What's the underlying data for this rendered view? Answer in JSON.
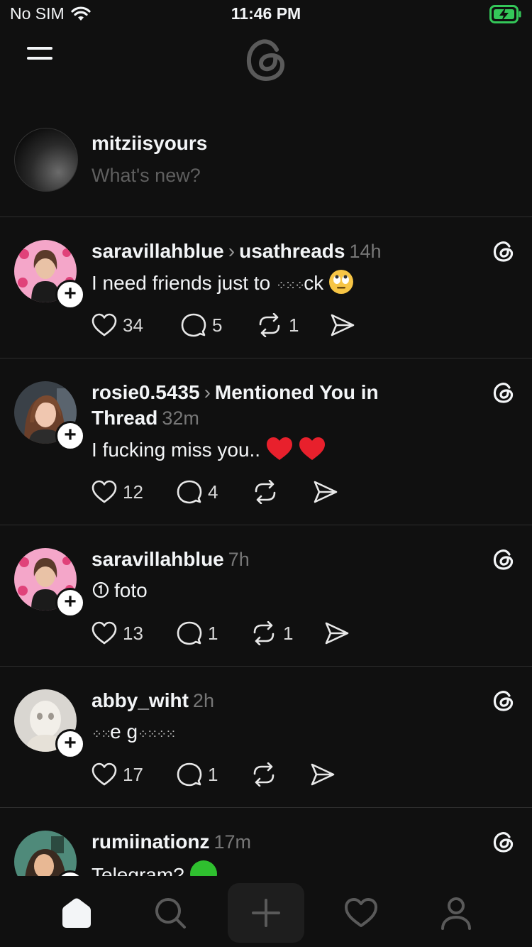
{
  "status": {
    "carrier": "No SIM",
    "time": "11:46 PM"
  },
  "composer": {
    "username": "mitziisyours",
    "placeholder": "What's new?"
  },
  "posts": [
    {
      "user": "saravillahblue",
      "target": "usathreads",
      "time": "14h",
      "text": "I need friends just to ",
      "text_tail": "ck",
      "likes": "34",
      "replies": "5",
      "reposts": "1"
    },
    {
      "user": "rosie0.5435",
      "target": "Mentioned You in Thread",
      "time": "32m",
      "text": "I fucking miss you..",
      "likes": "12",
      "replies": "4",
      "reposts": ""
    },
    {
      "user": "saravillahblue",
      "target": "",
      "time": "7h",
      "text": "foto",
      "likes": "13",
      "replies": "1",
      "reposts": "1"
    },
    {
      "user": "abby_wiht",
      "target": "",
      "time": "2h",
      "text": "e g",
      "likes": "17",
      "replies": "1",
      "reposts": ""
    },
    {
      "user": "rumiinationz",
      "target": "",
      "time": "17m",
      "text": "Telegram?",
      "likes": "",
      "replies": "",
      "reposts": ""
    }
  ],
  "icons": {
    "menu": "hamburger-icon",
    "logo": "threads-logo-icon",
    "like": "heart-icon",
    "reply": "comment-icon",
    "repost": "repost-icon",
    "share": "send-icon",
    "home": "home-icon",
    "search": "search-icon",
    "create": "plus-icon",
    "activity": "heart-icon",
    "profile": "profile-icon"
  },
  "colors": {
    "background": "#101010",
    "text": "#f3f5f7",
    "muted": "#777777",
    "divider": "#2d2d2d",
    "battery": "#34c759"
  }
}
